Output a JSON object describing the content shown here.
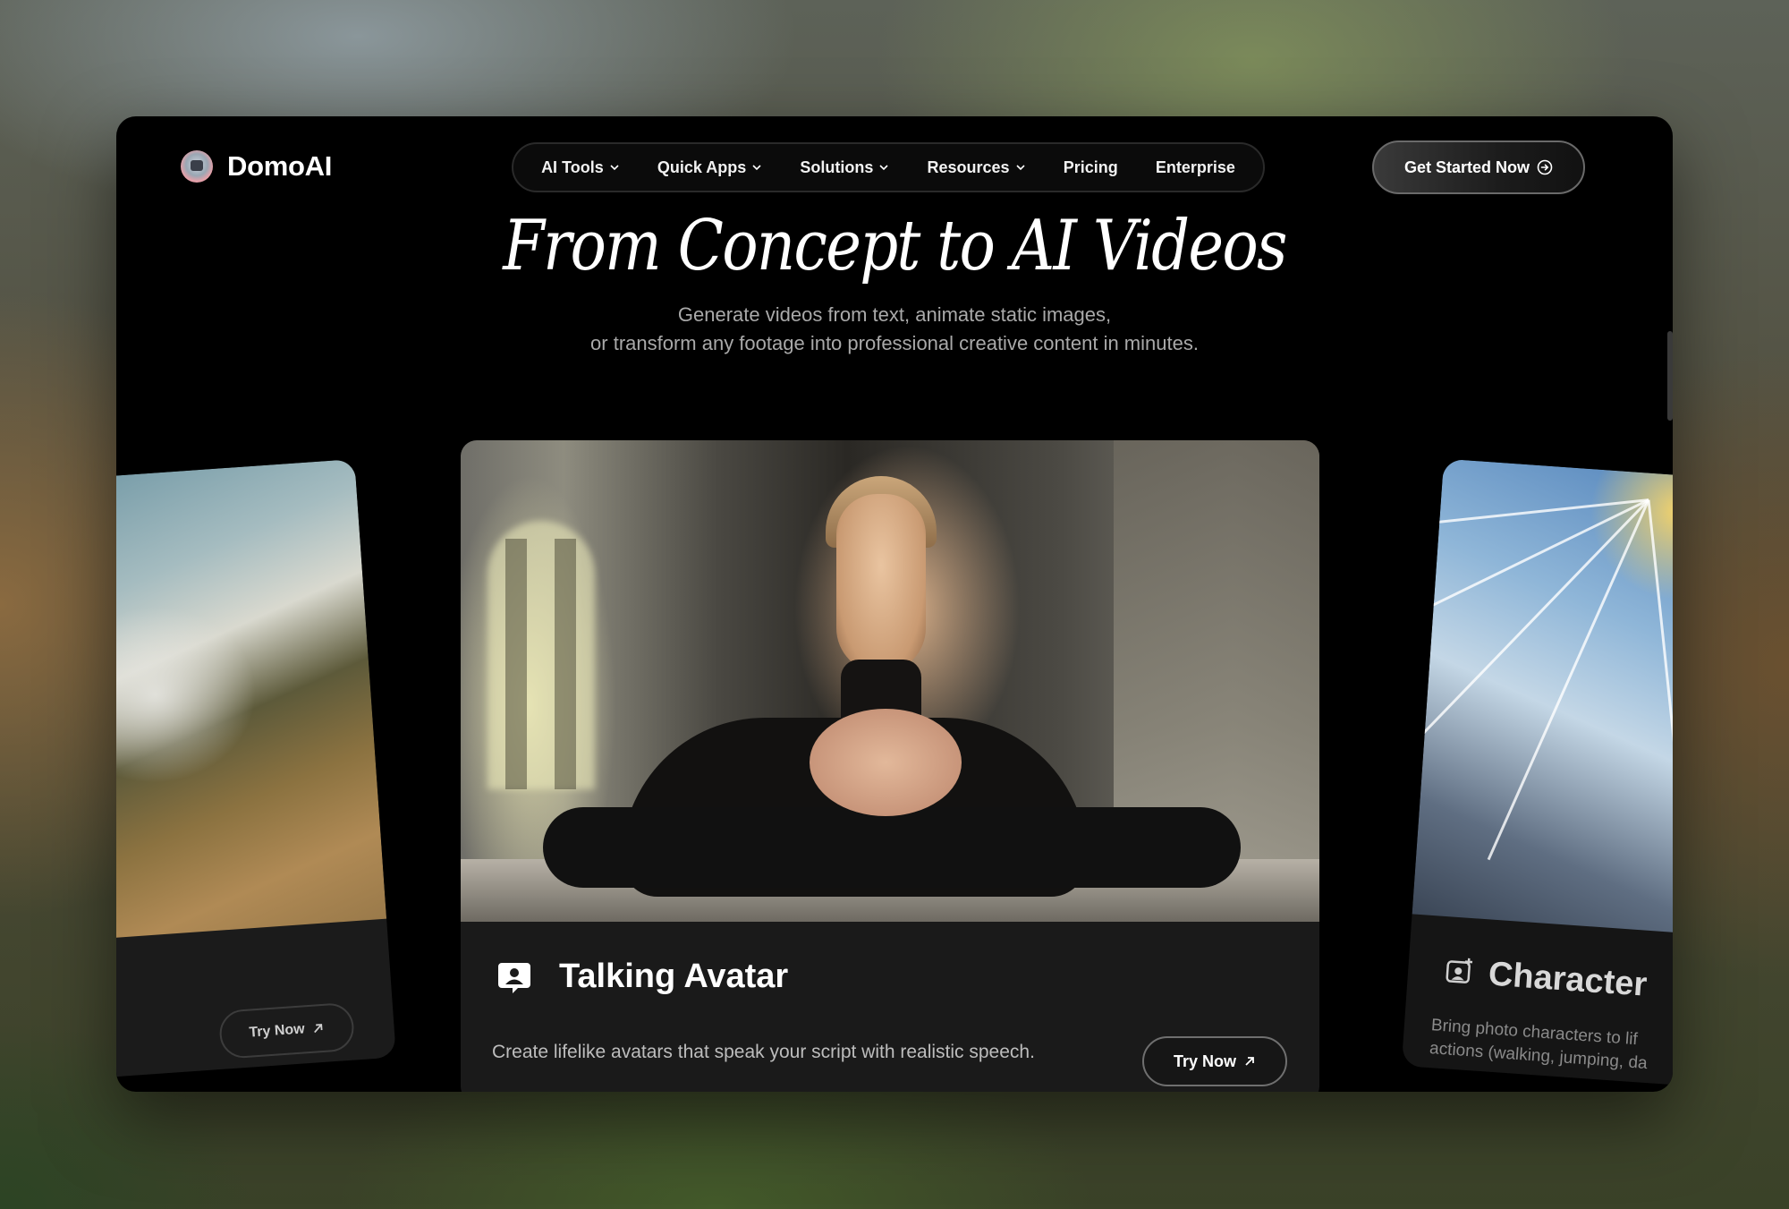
{
  "brand": {
    "name": "DomoAI"
  },
  "nav": {
    "items": [
      {
        "label": "AI Tools",
        "has_dropdown": true
      },
      {
        "label": "Quick Apps",
        "has_dropdown": true
      },
      {
        "label": "Solutions",
        "has_dropdown": true
      },
      {
        "label": "Resources",
        "has_dropdown": true
      },
      {
        "label": "Pricing",
        "has_dropdown": false
      },
      {
        "label": "Enterprise",
        "has_dropdown": false
      }
    ],
    "cta": "Get Started Now"
  },
  "hero": {
    "title": "From Concept to AI Videos",
    "subtitle_line1": "Generate videos from text, animate static images,",
    "subtitle_line2": "or transform any footage into professional creative content in minutes."
  },
  "cards": {
    "left": {
      "button": "Try Now"
    },
    "main": {
      "icon": "talking-avatar-icon",
      "title": "Talking Avatar",
      "description": "Create lifelike avatars that speak your script with realistic speech.",
      "button": "Try Now"
    },
    "right": {
      "icon": "character-image-icon",
      "title": "Character",
      "description_line1": "Bring photo characters to lif",
      "description_line2": "actions (walking, jumping, da"
    }
  },
  "colors": {
    "background": "#000000",
    "card": "#1a1a1a",
    "text": "#ffffff",
    "muted": "#a9a9a9"
  }
}
